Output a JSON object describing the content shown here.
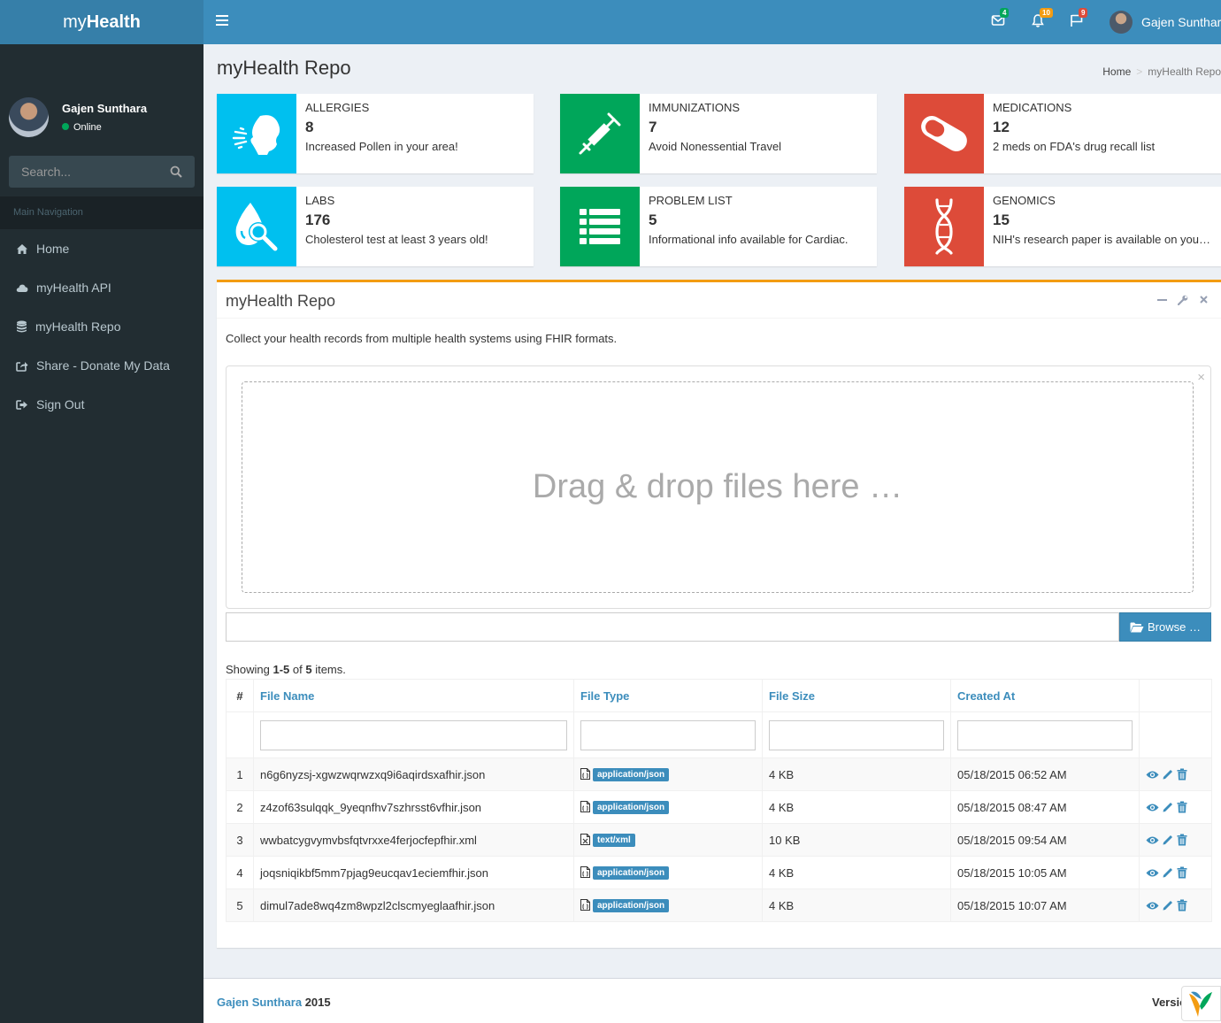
{
  "app": {
    "brand_light": "my",
    "brand_bold": "Health"
  },
  "topbar": {
    "messages_badge": "4",
    "notifications_badge": "10",
    "tasks_badge": "9",
    "user_name": "Gajen Sunthara",
    "colors": {
      "messages": "#00a65a",
      "notifications": "#f39c12",
      "tasks": "#dd4b39"
    }
  },
  "sidebar": {
    "user_name": "Gajen Sunthara",
    "status": "Online",
    "search_placeholder": "Search...",
    "nav_header": "Main Navigation",
    "items": [
      {
        "label": "Home",
        "icon": "home-icon"
      },
      {
        "label": "myHealth API",
        "icon": "cloud-icon"
      },
      {
        "label": "myHealth Repo",
        "icon": "database-icon"
      },
      {
        "label": "Share - Donate My Data",
        "icon": "share-icon"
      },
      {
        "label": "Sign Out",
        "icon": "sign-out-icon"
      }
    ]
  },
  "header": {
    "title": "myHealth Repo",
    "breadcrumb_home": "Home",
    "breadcrumb_current": "myHealth Repo"
  },
  "info_boxes": [
    {
      "title": "Allergies",
      "number": "8",
      "message": "Increased Pollen in your area!",
      "color": "#00c0ef",
      "icon": "sneeze-icon"
    },
    {
      "title": "Immunizations",
      "number": "7",
      "message": "Avoid Nonessential Travel",
      "color": "#00a65a",
      "icon": "syringe-icon"
    },
    {
      "title": "Medications",
      "number": "12",
      "message": "2 meds on FDA's drug recall list",
      "color": "#dd4b39",
      "icon": "pill-icon"
    },
    {
      "title": "Labs",
      "number": "176",
      "message": "Cholesterol test at least 3 years old!",
      "color": "#00c0ef",
      "icon": "lab-test-icon"
    },
    {
      "title": "Problem List",
      "number": "5",
      "message": "Informational info available for Cardiac.",
      "color": "#00a65a",
      "icon": "list-icon"
    },
    {
      "title": "Genomics",
      "number": "15",
      "message": "NIH's research paper is available on your genomics data.",
      "color": "#dd4b39",
      "icon": "dna-icon"
    }
  ],
  "repo_box": {
    "title": "myHealth Repo",
    "description": "Collect your health records from multiple health systems using FHIR formats.",
    "drop_text": "Drag & drop files here …",
    "browse_label": "Browse …",
    "summary_prefix": "Showing ",
    "summary_range": "1-5",
    "summary_mid": " of ",
    "summary_total": "5",
    "summary_suffix": " items.",
    "columns": {
      "num": "#",
      "file_name": "File Name",
      "file_type": "File Type",
      "file_size": "File Size",
      "created_at": "Created At"
    },
    "rows": [
      {
        "idx": "1",
        "name": "n6g6nyzsj-xgwzwqrwzxq9i6aqirdsxafhir.json",
        "type": "application/json",
        "size": "4 KB",
        "created": "05/18/2015 06:52 AM"
      },
      {
        "idx": "2",
        "name": "z4zof63sulqqk_9yeqnfhv7szhrsst6vfhir.json",
        "type": "application/json",
        "size": "4 KB",
        "created": "05/18/2015 08:47 AM"
      },
      {
        "idx": "3",
        "name": "wwbatcygvymvbsfqtvrxxe4ferjocfepfhir.xml",
        "type": "text/xml",
        "size": "10 KB",
        "created": "05/18/2015 09:54 AM"
      },
      {
        "idx": "4",
        "name": "joqsniqikbf5mm7pjag9eucqav1eciemfhir.json",
        "type": "application/json",
        "size": "4 KB",
        "created": "05/18/2015 10:05 AM"
      },
      {
        "idx": "5",
        "name": "dimul7ade8wq4zm8wpzl2clscmyeglaafhir.json",
        "type": "application/json",
        "size": "4 KB",
        "created": "05/18/2015 10:07 AM"
      }
    ]
  },
  "footer": {
    "author": "Gajen Sunthara",
    "year": " 2015",
    "version_label": "Version"
  }
}
